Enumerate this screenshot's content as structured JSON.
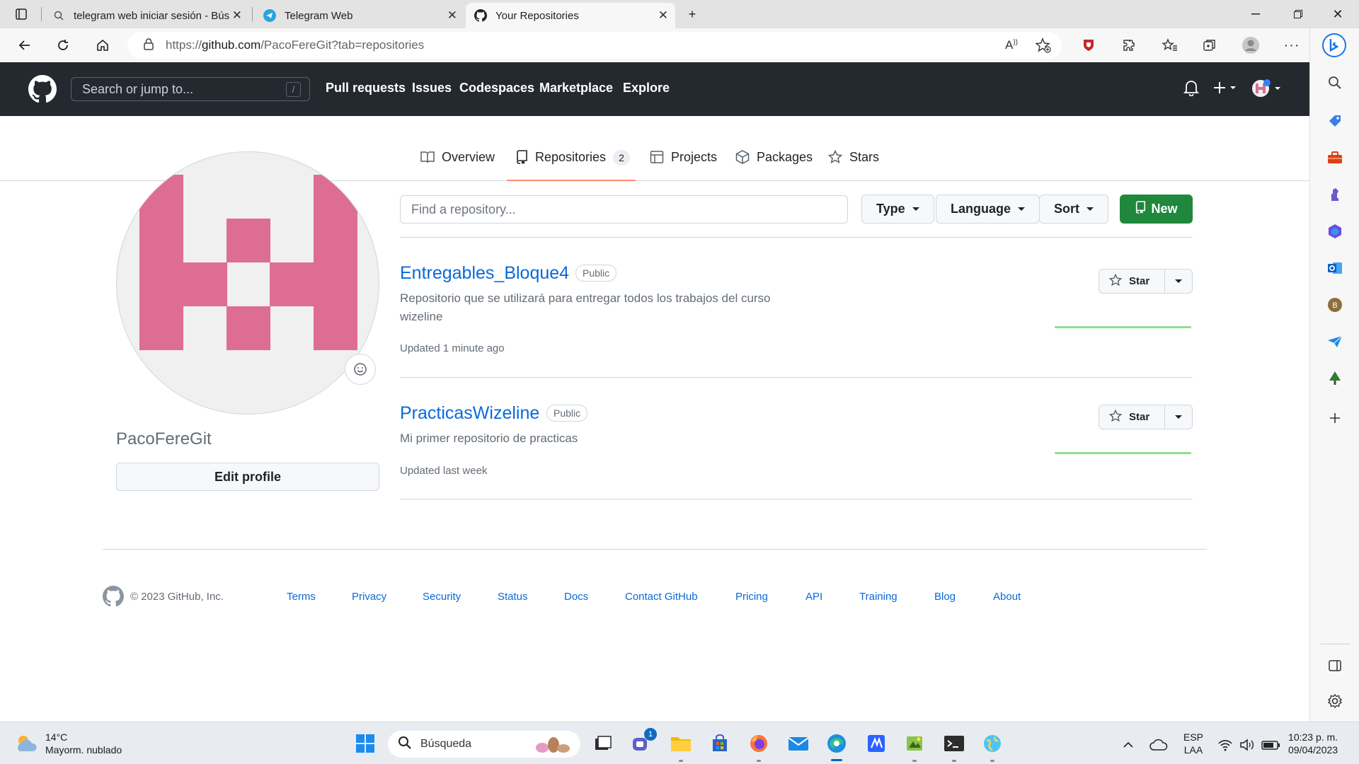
{
  "browser": {
    "tabs": [
      {
        "title": "telegram web iniciar sesión - Bús",
        "icon": "search-icon"
      },
      {
        "title": "Telegram Web",
        "icon": "telegram-icon"
      },
      {
        "title": "Your Repositories",
        "icon": "github-icon",
        "active": true
      }
    ],
    "url_prefix": "https://",
    "url_host": "github.com",
    "url_path": "/PacoFereGit?tab=repositories"
  },
  "header": {
    "search_placeholder": "Search or jump to...",
    "search_shortcut": "/",
    "nav": [
      "Pull requests",
      "Issues",
      "Codespaces",
      "Marketplace",
      "Explore"
    ]
  },
  "profile_tabs": [
    {
      "label": "Overview",
      "icon": "book-icon"
    },
    {
      "label": "Repositories",
      "icon": "repo-icon",
      "count": "2",
      "selected": true
    },
    {
      "label": "Projects",
      "icon": "table-icon"
    },
    {
      "label": "Packages",
      "icon": "package-icon"
    },
    {
      "label": "Stars",
      "icon": "star-icon"
    }
  ],
  "profile": {
    "username": "PacoFereGit",
    "edit_label": "Edit profile"
  },
  "repo_toolbar": {
    "filter_placeholder": "Find a repository...",
    "type_label": "Type",
    "language_label": "Language",
    "sort_label": "Sort",
    "new_label": "New"
  },
  "repos": [
    {
      "name": "Entregables_Bloque4",
      "visibility": "Public",
      "description": "Repositorio que se utilizará para entregar todos los trabajos del curso wizeline",
      "updated": "Updated 1 minute ago",
      "star_label": "Star"
    },
    {
      "name": "PracticasWizeline",
      "visibility": "Public",
      "description": "Mi primer repositorio de practicas",
      "updated": "Updated last week",
      "star_label": "Star"
    }
  ],
  "footer": {
    "copyright": "© 2023 GitHub, Inc.",
    "links": [
      "Terms",
      "Privacy",
      "Security",
      "Status",
      "Docs",
      "Contact GitHub",
      "Pricing",
      "API",
      "Training",
      "Blog",
      "About"
    ]
  },
  "taskbar": {
    "weather_temp": "14°C",
    "weather_desc": "Mayorm. nublado",
    "search_label": "Búsqueda",
    "teams_badge": "1",
    "lang_line1": "ESP",
    "lang_line2": "LAA",
    "time": "10:23 p. m.",
    "date": "09/04/2023"
  },
  "colors": {
    "header_bg": "#24292f",
    "link": "#0969da",
    "new_button": "#1f883d",
    "avatar_identicon": "#de6d93",
    "selected_tab_underline": "#fd8c73"
  }
}
